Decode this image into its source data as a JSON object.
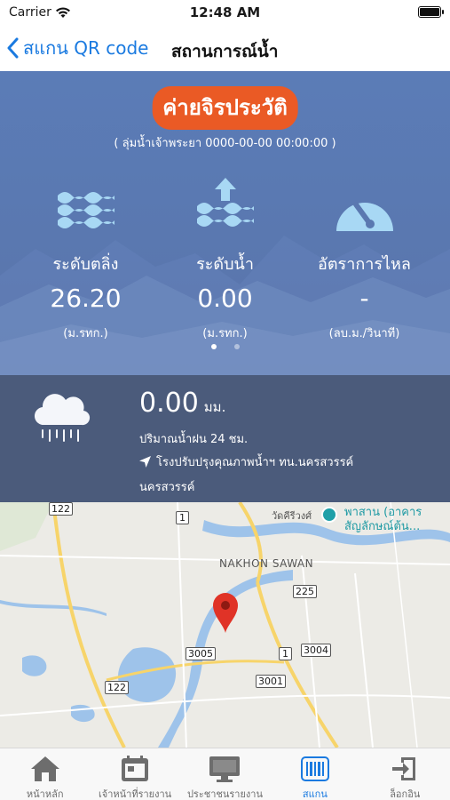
{
  "status_bar": {
    "carrier": "Carrier",
    "time": "12:48 AM"
  },
  "nav": {
    "back_label": "สแกน QR code",
    "title": "สถานการณ์น้ำ"
  },
  "station": {
    "name": "ค่ายจิรประวัติ",
    "subtitle": "( ลุ่มน้ำเจ้าพระยา 0000-00-00 00:00:00 )"
  },
  "metrics": [
    {
      "icon": "water-waves-icon",
      "label": "ระดับตลิ่ง",
      "value": "26.20",
      "unit": "(ม.รทก.)"
    },
    {
      "icon": "water-level-up-icon",
      "label": "ระดับน้ำ",
      "value": "0.00",
      "unit": "(ม.รทก.)"
    },
    {
      "icon": "flow-gauge-icon",
      "label": "อัตราการไหล",
      "value": "-",
      "unit": "(ลบ.ม./วินาที)"
    }
  ],
  "pager": {
    "pages": 2,
    "active_index": 0
  },
  "rain": {
    "icon": "rain-cloud-icon",
    "value": "0.00",
    "unit": "มม.",
    "description": "ปริมาณน้ำฝน 24 ชม.",
    "location": "โรงปรับปรุงคุณภาพน้ำฯ ทน.นครสวรรค์ นครสวรรค์"
  },
  "map": {
    "city_label": "NAKHON SAWAN",
    "poi_temple": "วัดคีรีวงศ์",
    "poi_building": "พาสาน (อาคาร สัญลักษณ์ต้น...",
    "road_shields": [
      "122",
      "1",
      "225",
      "3005",
      "1",
      "3004",
      "122",
      "3001"
    ],
    "colors": {
      "water": "#9ec3ea",
      "road_major": "#f7d46a",
      "land": "#ecebe6",
      "pin": "#e03327",
      "poi": "#1fa0a8"
    }
  },
  "tabs": [
    {
      "label": "หน้าหลัก",
      "icon": "home-icon",
      "active": false
    },
    {
      "label": "เจ้าหน้าที่รายงาน",
      "icon": "calendar-report-icon",
      "active": false
    },
    {
      "label": "ประชาชนรายงาน",
      "icon": "monitor-icon",
      "active": false
    },
    {
      "label": "สแกน",
      "icon": "barcode-scan-icon",
      "active": true
    },
    {
      "label": "ล็อกอิน",
      "icon": "login-icon",
      "active": false
    }
  ],
  "colors": {
    "accent": "#1a7ae0",
    "badge": "#ea5a25",
    "hero": "#5a78b0",
    "rain_panel": "#4b5b7b"
  }
}
